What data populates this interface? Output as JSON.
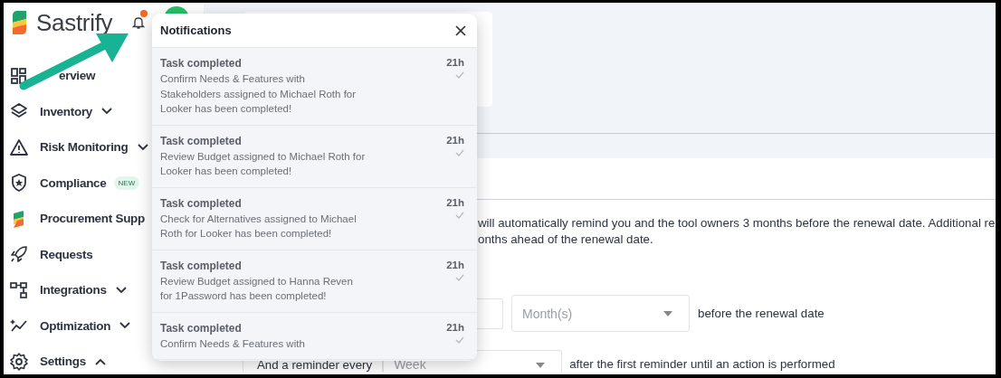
{
  "brand": {
    "name": "Sastrify"
  },
  "bell": {
    "unread": true
  },
  "sidebar": {
    "items": [
      {
        "label": "erview"
      },
      {
        "label": "Inventory",
        "expanded": false
      },
      {
        "label": "Risk Monitoring",
        "expanded": false
      },
      {
        "label": "Compliance",
        "badge": "NEW"
      },
      {
        "label": "Procurement Supp"
      },
      {
        "label": "Requests"
      },
      {
        "label": "Integrations",
        "expanded": false
      },
      {
        "label": "Optimization",
        "expanded": false
      },
      {
        "label": "Settings",
        "expanded": true
      }
    ]
  },
  "notifications": {
    "title": "Notifications",
    "items": [
      {
        "title": "Task completed",
        "time": "21h",
        "body_lines": [
          "Confirm Needs & Features with",
          "Stakeholders assigned to Michael Roth for",
          "Looker has been completed!"
        ]
      },
      {
        "title": "Task completed",
        "time": "21h",
        "body_lines": [
          "Review Budget assigned to Michael Roth for",
          "Looker has been completed!"
        ]
      },
      {
        "title": "Task completed",
        "time": "21h",
        "body_lines": [
          "Check for Alternatives assigned to Michael",
          "Roth for Looker has been completed!"
        ]
      },
      {
        "title": "Task completed",
        "time": "21h",
        "body_lines": [
          "Review Budget assigned to Hanna Reven",
          "for 1Password has been completed!"
        ]
      },
      {
        "title": "Task completed",
        "time": "21h",
        "body_lines": [
          "Confirm Needs & Features with"
        ]
      }
    ]
  },
  "main": {
    "description": [
      "will automatically remind you and the tool owners 3 months before the renewal date. Additional re",
      "onths ahead of the renewal date."
    ],
    "first_reminder": {
      "unit_placeholder": "Month(s)",
      "suffix": "before the renewal date"
    },
    "repeat_reminder": {
      "prefix": "And a reminder every",
      "unit_placeholder": "Week",
      "suffix": "after the first reminder until an action is performed"
    }
  }
}
